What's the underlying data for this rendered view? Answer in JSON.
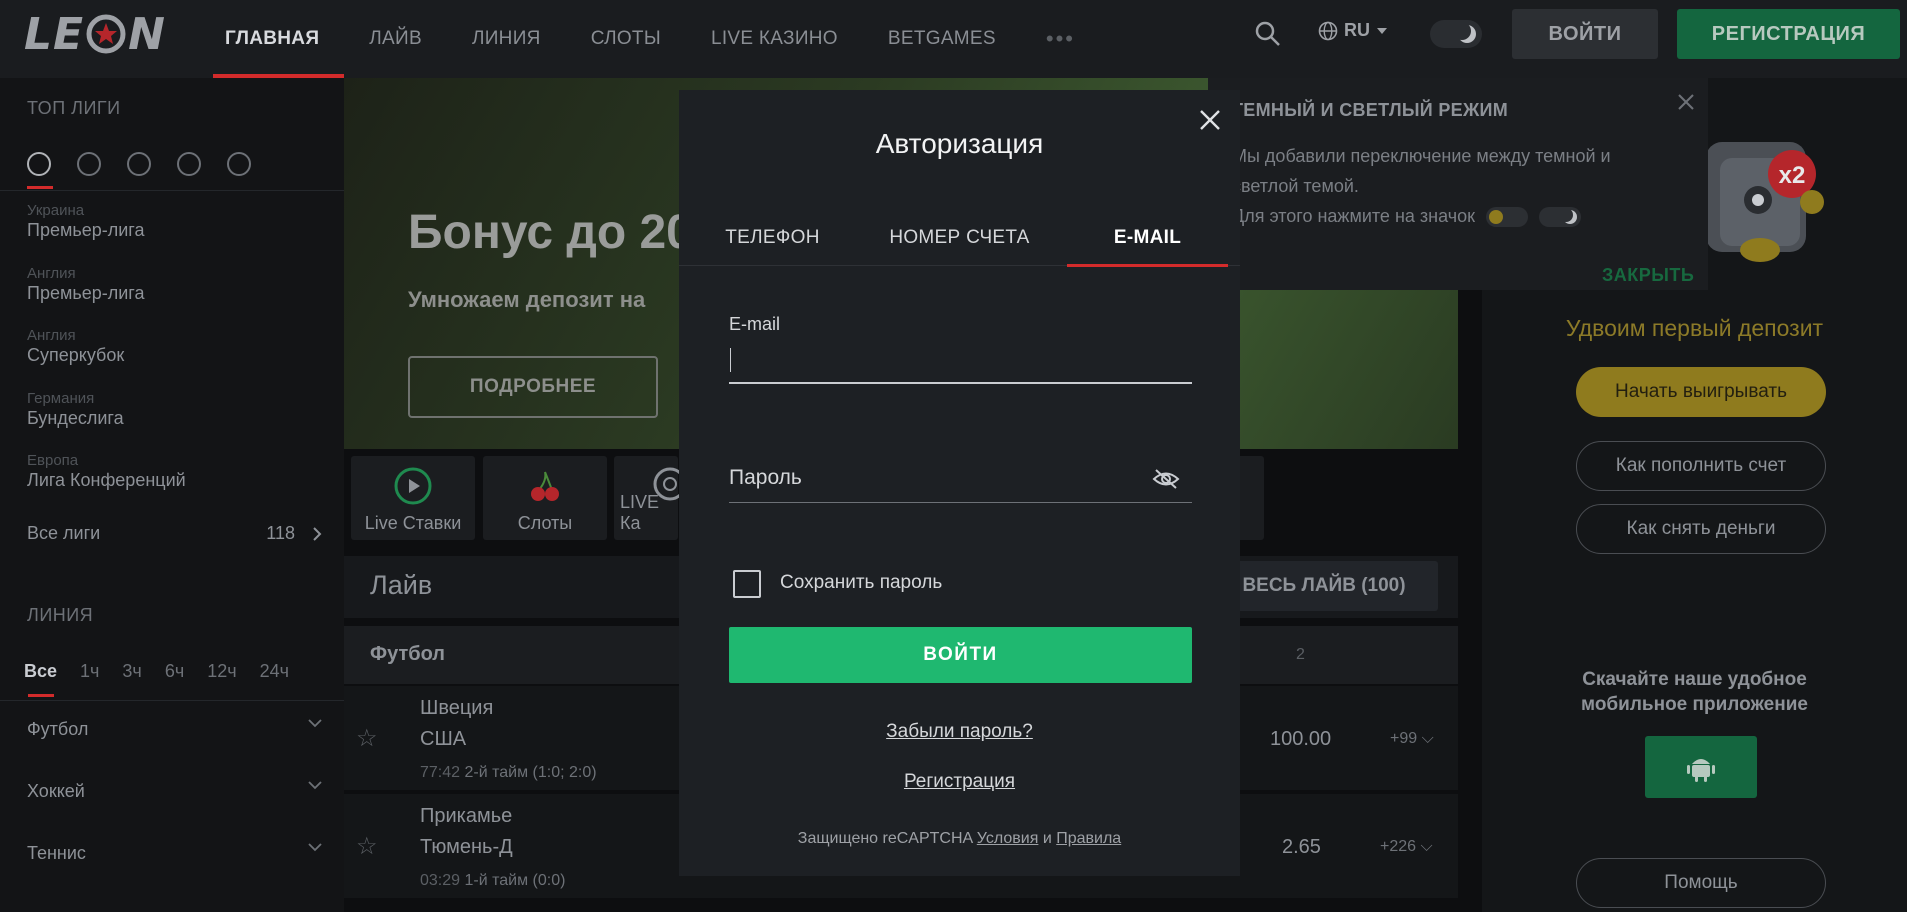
{
  "header": {
    "logo": "LEON",
    "nav": [
      "ГЛАВНАЯ",
      "ЛАЙВ",
      "ЛИНИЯ",
      "СЛОТЫ",
      "LIVE КАЗИНО",
      "BETGAMES"
    ],
    "language": "RU",
    "login_label": "ВОЙТИ",
    "register_label": "РЕГИСТРАЦИЯ"
  },
  "sidebar": {
    "top_leagues_title": "ТОП ЛИГИ",
    "leagues": [
      {
        "country": "Украина",
        "name": "Премьер-лига"
      },
      {
        "country": "Англия",
        "name": "Премьер-лига"
      },
      {
        "country": "Англия",
        "name": "Суперкубок"
      },
      {
        "country": "Германия",
        "name": "Бундеслига"
      },
      {
        "country": "Европа",
        "name": "Лига Конференций"
      }
    ],
    "all_leagues_label": "Все лиги",
    "all_leagues_count": "118",
    "line_title": "ЛИНИЯ",
    "time_filters": [
      "Все",
      "1ч",
      "3ч",
      "6ч",
      "12ч",
      "24ч"
    ],
    "sports": [
      "Футбол",
      "Хоккей",
      "Теннис"
    ]
  },
  "banner": {
    "title": "Бонус до 20",
    "subtitle": "Умножаем депозит на",
    "button": "ПОДРОБНЕЕ"
  },
  "quick_links": [
    "Live Ставки",
    "Слоты",
    "LIVE Ка"
  ],
  "live": {
    "title": "Лайв",
    "all_live_label": "ВЕСЬ ЛАЙВ (100)",
    "sport_title": "Футбол",
    "col_header": "2",
    "matches": [
      {
        "team1": "Швеция",
        "team2": "США",
        "clock": "77:42",
        "status": "2-й тайм (1:0; 2:0)",
        "odd": "100.00",
        "more": "+99"
      },
      {
        "team1": "Прикамье",
        "team2": "Тюмень-Д",
        "clock": "03:29",
        "status": "1-й тайм (0:0)",
        "odd": "2.65",
        "more": "+226"
      }
    ]
  },
  "tooltip": {
    "title": "ТЕМНЫЙ И СВЕТЛЫЙ РЕЖИМ",
    "line1": "Мы добавили переключение между темной и",
    "line2": "светлой темой.",
    "line3": "Для этого нажмите на значок",
    "close_label": "ЗАКРЫТЬ"
  },
  "promo": {
    "badge": "x2",
    "title": "Удвоим первый депозит",
    "cta": "Начать выигрывать",
    "how_deposit": "Как пополнить счет",
    "how_withdraw": "Как снять деньги",
    "app_line1": "Скачайте наше удобное",
    "app_line2": "мобильное приложение",
    "help": "Помощь"
  },
  "modal": {
    "title": "Авторизация",
    "tabs": [
      "ТЕЛЕФОН",
      "НОМЕР СЧЕТА",
      "E-MAIL"
    ],
    "email_label": "E-mail",
    "email_value": "",
    "password_placeholder": "Пароль",
    "remember_label": "Сохранить пароль",
    "submit_label": "ВОЙТИ",
    "forgot_label": "Забыли пароль?",
    "register_label": "Регистрация",
    "captcha_prefix": "Защищено reCAPTCHA",
    "captcha_terms": "Условия",
    "captcha_and": "и",
    "captcha_rules": "Правила"
  },
  "colors": {
    "accent_red": "#d32b2b",
    "submit_green": "#1fb870",
    "register_green": "#14663f",
    "promo_gold": "#8f7b1e"
  },
  "icons": [
    "search-icon",
    "globe-icon",
    "chevron-down-icon",
    "moon-icon",
    "close-icon",
    "eye-off-icon",
    "star-icon",
    "chevron-right-icon",
    "android-icon",
    "play-icon",
    "cherry-icon",
    "roulette-icon"
  ]
}
